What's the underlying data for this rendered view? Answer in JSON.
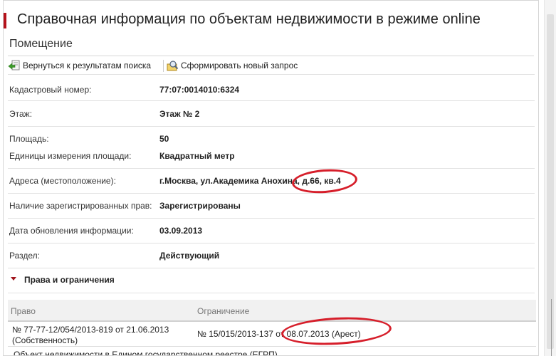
{
  "page": {
    "title": "Справочная информация по объектам недвижимости в режиме online",
    "subtitle": "Помещение"
  },
  "toolbar": {
    "back_label": "Вернуться к результатам поиска",
    "new_request_label": "Сформировать новый запрос"
  },
  "info_rows": [
    {
      "label": "Кадастровый номер:",
      "value": "77:07:0014010:6324"
    },
    {
      "label": "Этаж:",
      "value": "Этаж № 2"
    },
    {
      "label": "Площадь:",
      "value": "50"
    },
    {
      "label": "Единицы измерения площади:",
      "value": "Квадратный метр"
    },
    {
      "label": "Адреса (местоположение):",
      "value": "г.Москва, ул.Академика Анохина, д.66, кв.4"
    },
    {
      "label": "Наличие зарегистрированных прав:",
      "value": "Зарегистрированы"
    },
    {
      "label": "Дата обновления информации:",
      "value": "03.09.2013"
    },
    {
      "label": "Раздел:",
      "value": "Действующий"
    }
  ],
  "rights": {
    "section_title": "Права и ограничения",
    "col_right": "Право",
    "col_restriction": "Ограничение",
    "rows": [
      {
        "right_line1": "№ 77-77-12/054/2013-819  от 21.06.2013",
        "right_line2": "(Собственность)",
        "restriction": "№ 15/015/2013-137  от 08.07.2013  (Арест)"
      }
    ]
  },
  "footer_partial_text": "Объект недвижимости в Едином государственном реестре (ЕГРП)",
  "colors": {
    "accent": "#b5121b",
    "annotation": "#d61e2a"
  }
}
